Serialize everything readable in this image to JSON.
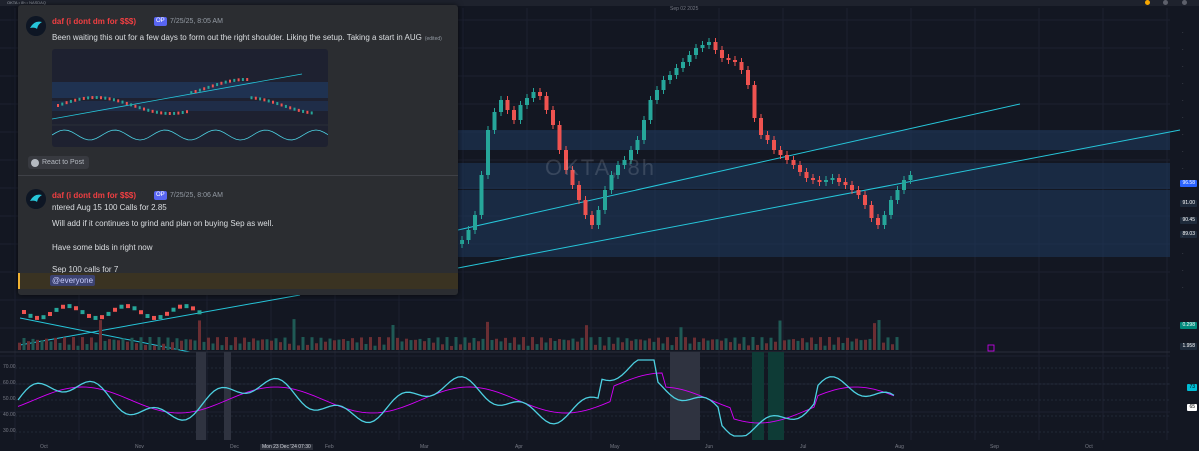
{
  "chart": {
    "symbol_watermark": "OKTA, 8h",
    "ticker_info": "OKTA • 8h • NASDAQ",
    "date_top": "Sep 02 2025",
    "x_axis_labels": [
      "Oct",
      "Nov",
      "Dec",
      "Feb",
      "Mar",
      "Apr",
      "May",
      "Jun",
      "Jul",
      "Aug",
      "Sep",
      "Oct"
    ],
    "crosshair_date": "Mon 23 Dec '24",
    "crosshair_time": "07:30",
    "price_tags": [
      {
        "value": "96.58",
        "color": "#2962ff"
      },
      {
        "value": "91.00",
        "color": "#1e2a3a"
      },
      {
        "value": "90.45",
        "color": "#1e2a3a"
      },
      {
        "value": "89.03",
        "color": "#1e2a3a"
      },
      {
        "value": "0.298",
        "color": "#00897b"
      },
      {
        "value": "1.958",
        "color": "#1e2a3a"
      }
    ],
    "osc_axis_labels": [
      "70.00",
      "60.00",
      "50.00",
      "40.00",
      "30.00"
    ],
    "osc_tags": [
      {
        "value": "73",
        "color": "#00bcd4"
      },
      {
        "value": "65",
        "color": "#ffffff"
      }
    ],
    "colors": {
      "up": "#26a69a",
      "down": "#ef5350",
      "zone": "#1f3a5f",
      "trendline": "#26c6da",
      "osc_main": "#4dd0e1",
      "osc_signal": "#d500f9"
    }
  },
  "discord": {
    "message1": {
      "username": "daf (i dont dm for $$$)",
      "badge": "OP",
      "timestamp": "7/25/25, 8:05 AM",
      "text": "Been waiting this out for a few days to form out the right shoulder. Liking the setup. Taking a start in AUG",
      "edited": "(edited)"
    },
    "react_button": "React to Post",
    "message2": {
      "username": "daf (i dont dm for $$$)",
      "badge": "OP",
      "timestamp": "7/25/25, 8:06 AM",
      "lines": [
        "ntered Aug 15 100 Calls for 2.85",
        "Will add if it continues to grind and plan on buying Sep as well.",
        "",
        "Have some bids in right now",
        "",
        "Sep 100 calls for 7"
      ],
      "mention": "@everyone"
    }
  }
}
